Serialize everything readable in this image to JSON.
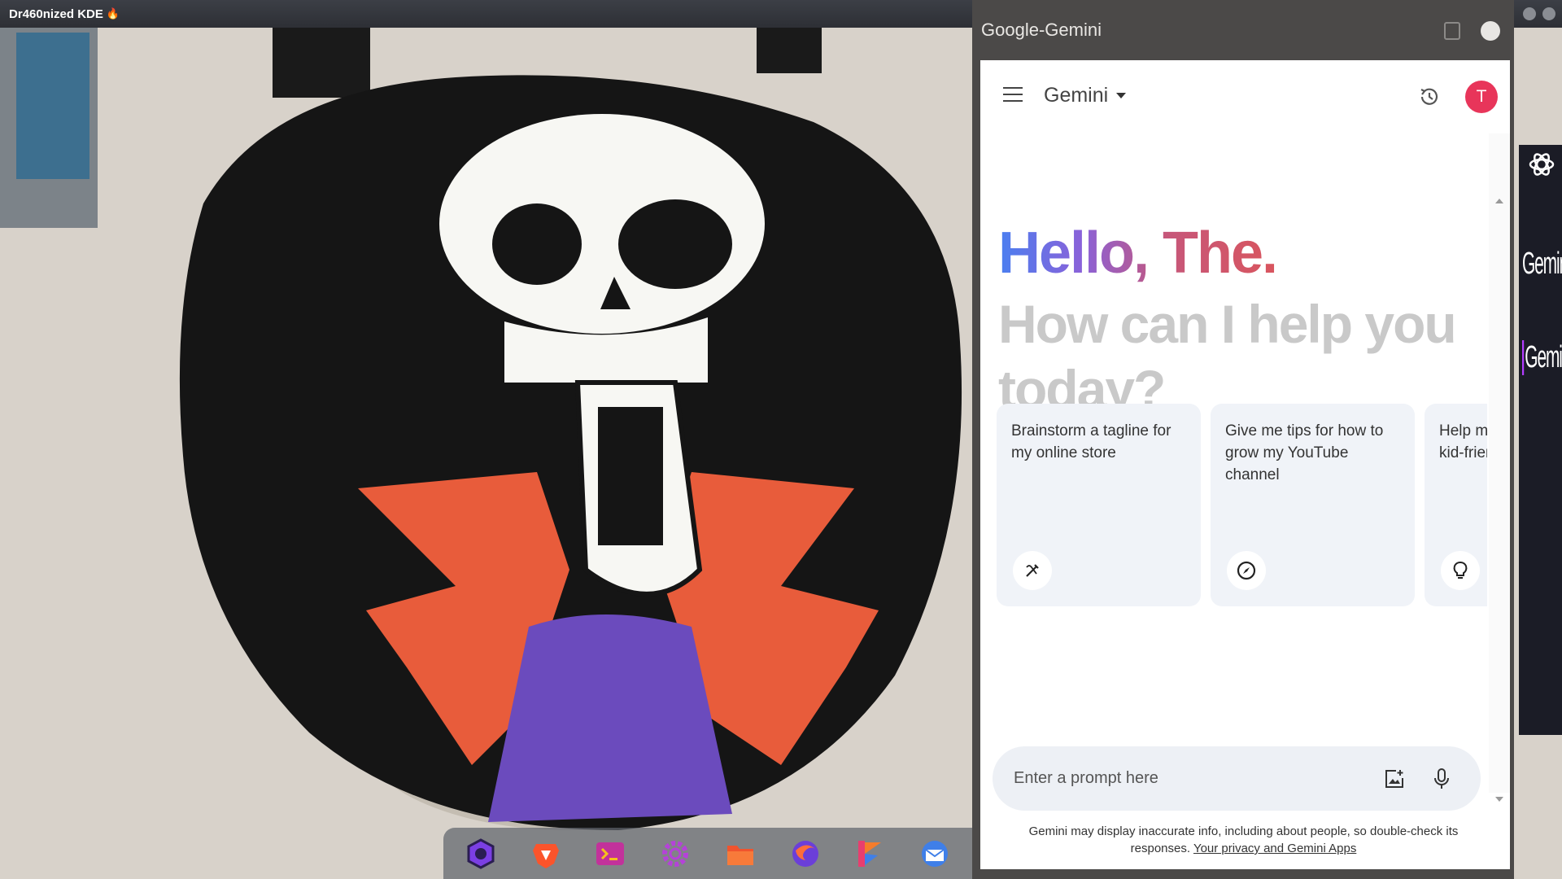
{
  "top_panel": {
    "title": "Dr460nized KDE",
    "title_icon": "flame-icon"
  },
  "dock": {
    "apps": [
      {
        "name": "dragon-app-icon",
        "color": "#7b3fe4"
      },
      {
        "name": "brave-browser-icon",
        "color": "#fb542b"
      },
      {
        "name": "terminal-icon",
        "color": "#c2329b"
      },
      {
        "name": "settings-icon",
        "color": "#b542d9"
      },
      {
        "name": "file-manager-icon",
        "color": "#f0542e"
      },
      {
        "name": "firefox-icon",
        "color": "#6b3fd8"
      },
      {
        "name": "flameshot-icon",
        "color": "#e83e6f"
      },
      {
        "name": "thunderbird-icon",
        "color": "#3f7fe8"
      }
    ]
  },
  "edge_sidebar": {
    "items": [
      {
        "label": "Gemini"
      },
      {
        "label": "Gemini"
      }
    ]
  },
  "window": {
    "title": "Google-Gemini"
  },
  "app": {
    "name": "Gemini",
    "avatar_letter": "T",
    "avatar_color": "#e8355a",
    "greeting": "Hello, The.",
    "subheading": "How can I help you today?",
    "cards": [
      {
        "text": "Brainstorm a tagline for my online store",
        "icon": "pen-sparkle-icon"
      },
      {
        "text": "Give me tips for how to grow my YouTube channel",
        "icon": "compass-icon"
      },
      {
        "text": "Help me decorate in a kid-friendly way",
        "icon": "lightbulb-icon"
      }
    ],
    "prompt_placeholder": "Enter a prompt here",
    "disclaimer": "Gemini may display inaccurate info, including about people, so double-check its responses.",
    "privacy_link": "Your privacy and Gemini Apps"
  }
}
